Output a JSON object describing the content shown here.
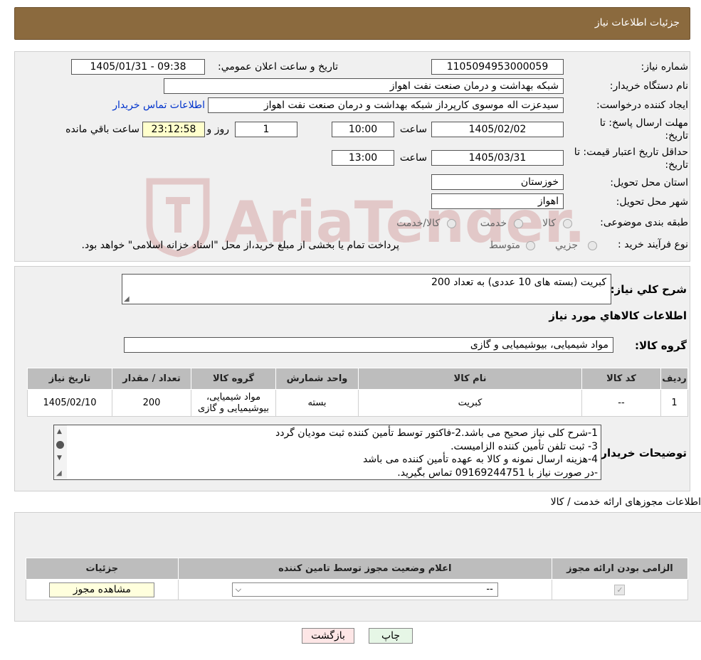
{
  "header": {
    "title": "جزئیات اطلاعات نیاز"
  },
  "watermark": {
    "text": "AriaTender.neT"
  },
  "info": {
    "need_number_label": "شماره نیاز:",
    "need_number": "1105094953000059",
    "announce_label": "تاريخ و ساعت اعلان عمومي:",
    "announce_value": "1405/01/31 - 09:38",
    "buyer_org_label": "نام دستگاه خريدار:",
    "buyer_org": "شبکه بهداشت و درمان صنعت نفت اهواز",
    "creator_label": "ايجاد کننده درخواست:",
    "creator": "سیدعزت اله موسوی کارپرداز شبکه بهداشت و درمان صنعت نفت اهواز",
    "contact_link": "اطلاعات تماس خريدار",
    "deadline_label_1": "مهلت ارسال پاسخ: تا",
    "deadline_label_2": "تاريخ:",
    "deadline_date": "1405/02/02",
    "time_label": "ساعت",
    "deadline_time": "10:00",
    "days_value": "1",
    "days_label": "روز و",
    "remaining_value": "23:12:58",
    "remaining_label": "ساعت باقي مانده",
    "validity_label_1": "حداقل تاريخ اعتبار قيمت: تا",
    "validity_label_2": "تاريخ:",
    "validity_date": "1405/03/31",
    "validity_time": "13:00",
    "province_label": "استان محل تحويل:",
    "province": "خوزستان",
    "city_label": "شهر محل تحويل:",
    "city": "اهواز",
    "category_label": "طبقه بندی موضوعی:",
    "category_options": [
      "کالا",
      "خدمت",
      "کالا/خدمت"
    ],
    "process_label": "نوع فرآيند خريد :",
    "process_options": [
      "جزيي",
      "متوسط"
    ],
    "process_note": "پرداخت تمام يا بخشی از مبلغ خريد،از محل \"اسناد خزانه اسلامی\" خواهد بود."
  },
  "goods": {
    "summary_label": "شرح کلي نياز:",
    "summary": "کبریت (بسته های 10 عددی) به تعداد 200",
    "section_title": "اطلاعات کالاهاي مورد نياز",
    "group_label": "گروه کالا:",
    "group": "مواد شیمیایی، بیوشیمیایی و  گازی",
    "table_headers": [
      "رديف",
      "کد کالا",
      "نام کالا",
      "واحد شمارش",
      "گروه کالا",
      "تعداد / مقدار",
      "تاريخ نياز"
    ],
    "rows": [
      {
        "row": "1",
        "code": "--",
        "name": "کبریت",
        "unit": "بسته",
        "group_1": "مواد شیمیایی،",
        "group_2": "بیوشیمیایی و گازی",
        "qty": "200",
        "date": "1405/02/10"
      }
    ],
    "buyer_notes_label": "توضيحات خريدار:",
    "buyer_notes": [
      "1-شرح کلی نیاز صحیح می باشد.2-فاکتور توسط تأمین کننده ثبت مودیان گردد",
      " 3- ثبت تلفن تأمین کننده الزامیست.",
      "4-هزینه ارسال نمونه و کالا به عهده تأمین کننده می باشد",
      "-در صورت نیاز با 09169244751 تماس بگیرید."
    ]
  },
  "permits": {
    "section_title": "اطلاعات مجوزهای ارائه خدمت / کالا",
    "headers": [
      "الزامی بودن ارائه مجوز",
      "اعلام وضعیت مجوز توسط تامین کننده",
      "جزئیات"
    ],
    "select_value": "--",
    "view_button": "مشاهده مجوز"
  },
  "footer": {
    "print_button": "چاپ",
    "back_button": "بازگشت"
  }
}
